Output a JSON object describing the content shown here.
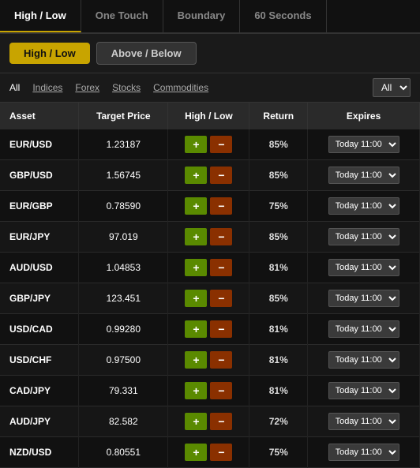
{
  "tabs": {
    "top": [
      {
        "label": "High / Low",
        "active": true
      },
      {
        "label": "One Touch",
        "active": false
      },
      {
        "label": "Boundary",
        "active": false
      },
      {
        "label": "60 Seconds",
        "active": false
      }
    ],
    "sub": [
      {
        "label": "High / Low",
        "active": true
      },
      {
        "label": "Above / Below",
        "active": false
      }
    ]
  },
  "filters": {
    "items": [
      {
        "label": "All",
        "active": true
      },
      {
        "label": "Indices",
        "active": false
      },
      {
        "label": "Forex",
        "active": false
      },
      {
        "label": "Stocks",
        "active": false
      },
      {
        "label": "Commodities",
        "active": false
      }
    ],
    "select": {
      "options": [
        "All"
      ],
      "value": "All"
    }
  },
  "table": {
    "headers": [
      "Asset",
      "Target Price",
      "High / Low",
      "Return",
      "Expires"
    ],
    "rows": [
      {
        "asset": "EUR/USD",
        "price": "1.23187",
        "return": "85%",
        "expires": "Today 11:00"
      },
      {
        "asset": "GBP/USD",
        "price": "1.56745",
        "return": "85%",
        "expires": "Today 11:00"
      },
      {
        "asset": "EUR/GBP",
        "price": "0.78590",
        "return": "75%",
        "expires": "Today 11:00"
      },
      {
        "asset": "EUR/JPY",
        "price": "97.019",
        "return": "85%",
        "expires": "Today 11:00"
      },
      {
        "asset": "AUD/USD",
        "price": "1.04853",
        "return": "81%",
        "expires": "Today 11:00"
      },
      {
        "asset": "GBP/JPY",
        "price": "123.451",
        "return": "85%",
        "expires": "Today 11:00"
      },
      {
        "asset": "USD/CAD",
        "price": "0.99280",
        "return": "81%",
        "expires": "Today 11:00"
      },
      {
        "asset": "USD/CHF",
        "price": "0.97500",
        "return": "81%",
        "expires": "Today 11:00"
      },
      {
        "asset": "CAD/JPY",
        "price": "79.331",
        "return": "81%",
        "expires": "Today 11:00"
      },
      {
        "asset": "AUD/JPY",
        "price": "82.582",
        "return": "72%",
        "expires": "Today 11:00"
      },
      {
        "asset": "NZD/USD",
        "price": "0.80551",
        "return": "75%",
        "expires": "Today 11:00"
      }
    ],
    "btn_plus": "+",
    "btn_minus": "−"
  }
}
